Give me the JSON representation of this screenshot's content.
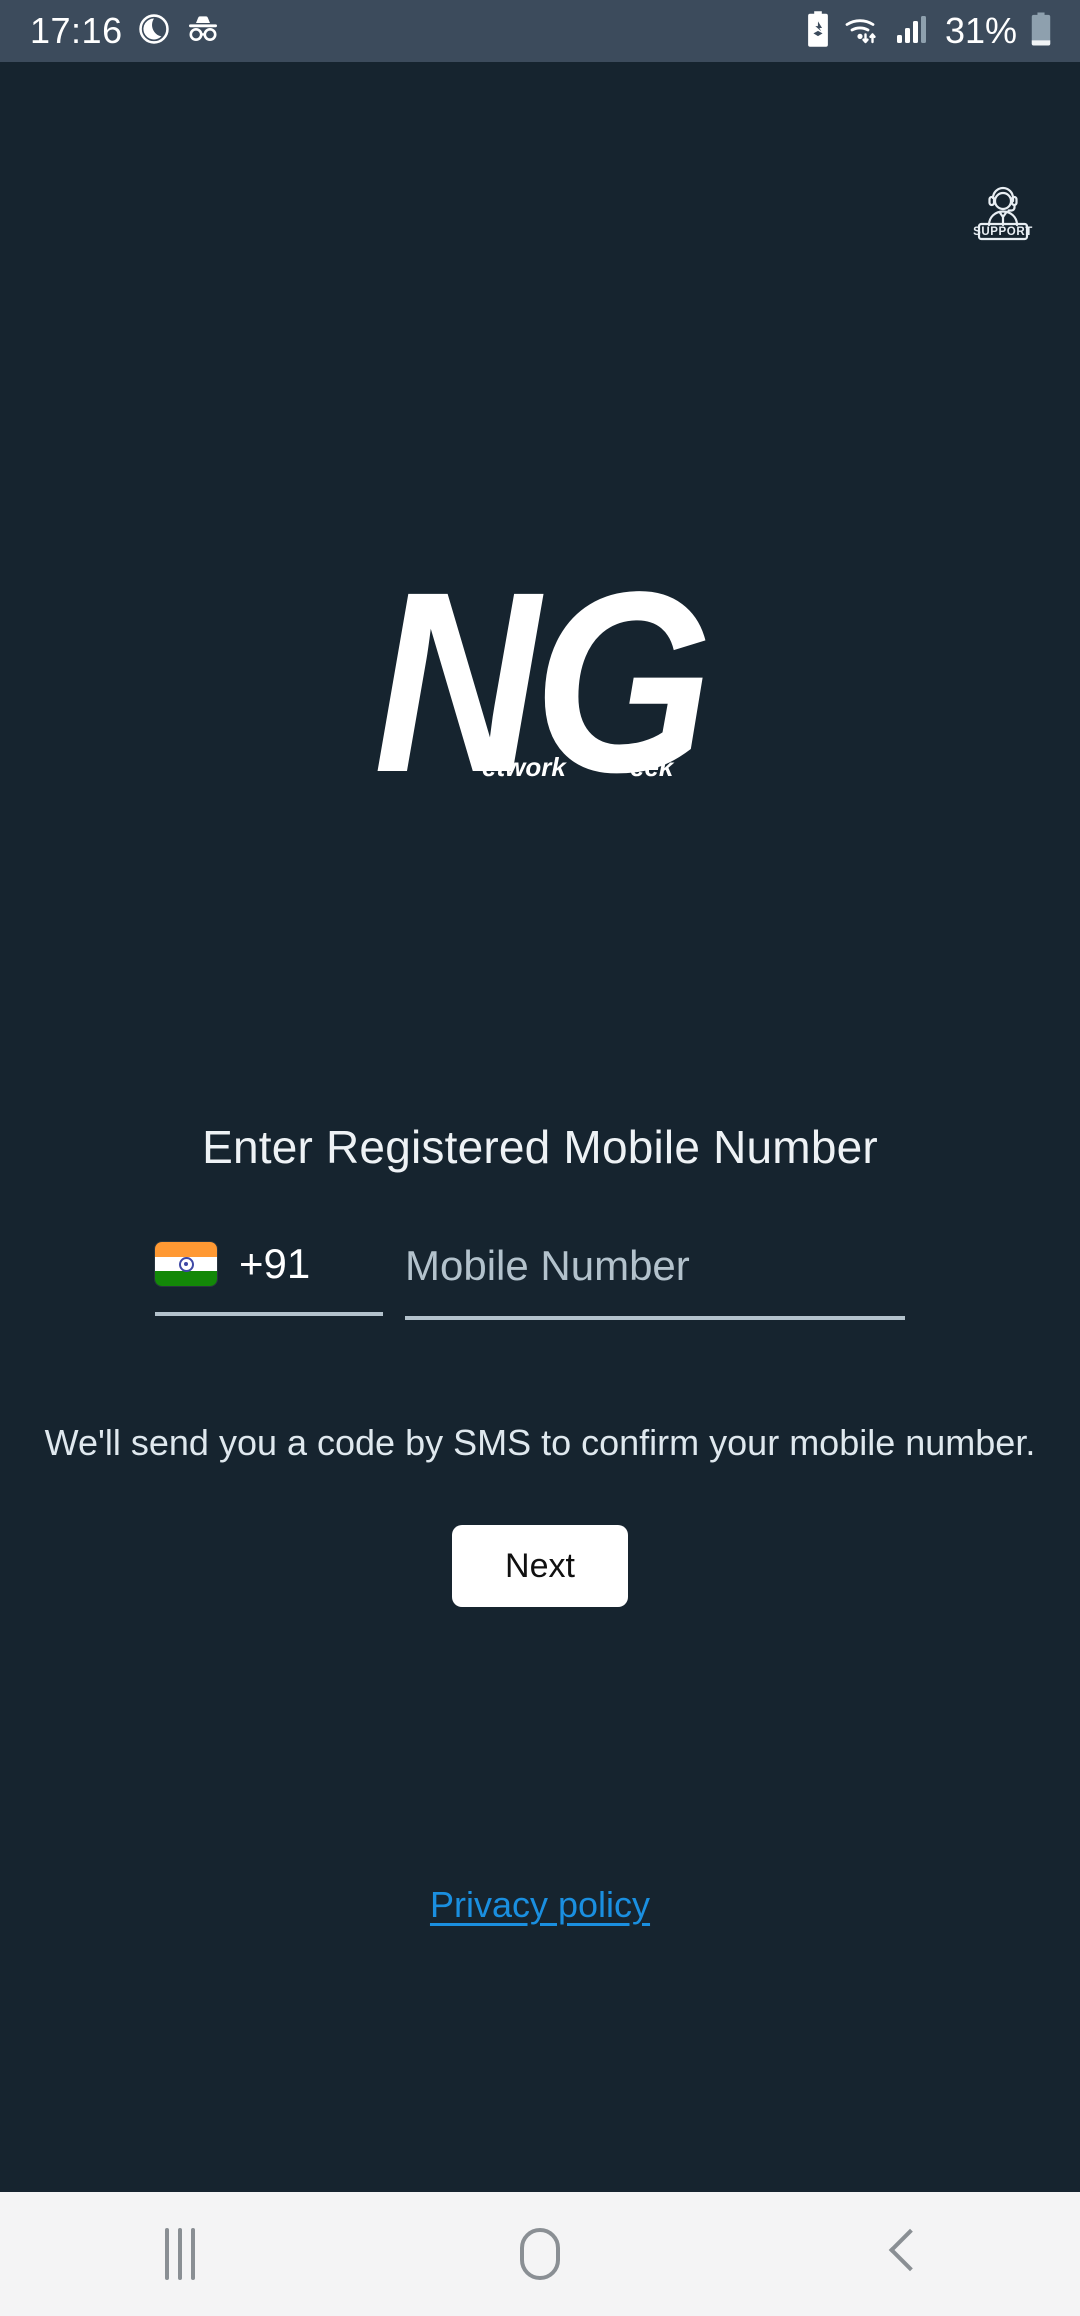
{
  "status_bar": {
    "clock": "17:16",
    "battery_percent": "31%",
    "icons": [
      "do-not-disturb-icon",
      "incognito-icon",
      "battery-saver-icon",
      "wifi-icon",
      "cellular-signal-icon",
      "battery-icon"
    ],
    "background_color": "#3c4b5c",
    "text_color": "#ffffff"
  },
  "app": {
    "background_color": "#16242f",
    "support": {
      "label": "SUPPORT",
      "icon": "support-agent-icon"
    },
    "logo": {
      "letters": "NG",
      "sub_left": "etwork",
      "sub_right": "eek",
      "full_name": "Network Geek",
      "color": "#ffffff"
    },
    "heading": "Enter Registered Mobile Number",
    "phone_entry": {
      "flag": "india-flag-icon",
      "country_code": "+91",
      "mobile_placeholder": "Mobile Number",
      "mobile_value": "",
      "underline_color": "#b3c2cc"
    },
    "helper_text": "We'll send you a code by SMS to confirm your mobile number.",
    "next_label": "Next",
    "next_bg_color": "#ffffff",
    "next_text_color": "#101010",
    "privacy_label": "Privacy policy",
    "privacy_color": "#1a8fe0"
  },
  "nav_bar": {
    "background_color": "#f4f4f5",
    "buttons": [
      {
        "name": "recents",
        "icon": "recents-icon"
      },
      {
        "name": "home",
        "icon": "home-icon"
      },
      {
        "name": "back",
        "icon": "back-icon"
      }
    ]
  }
}
